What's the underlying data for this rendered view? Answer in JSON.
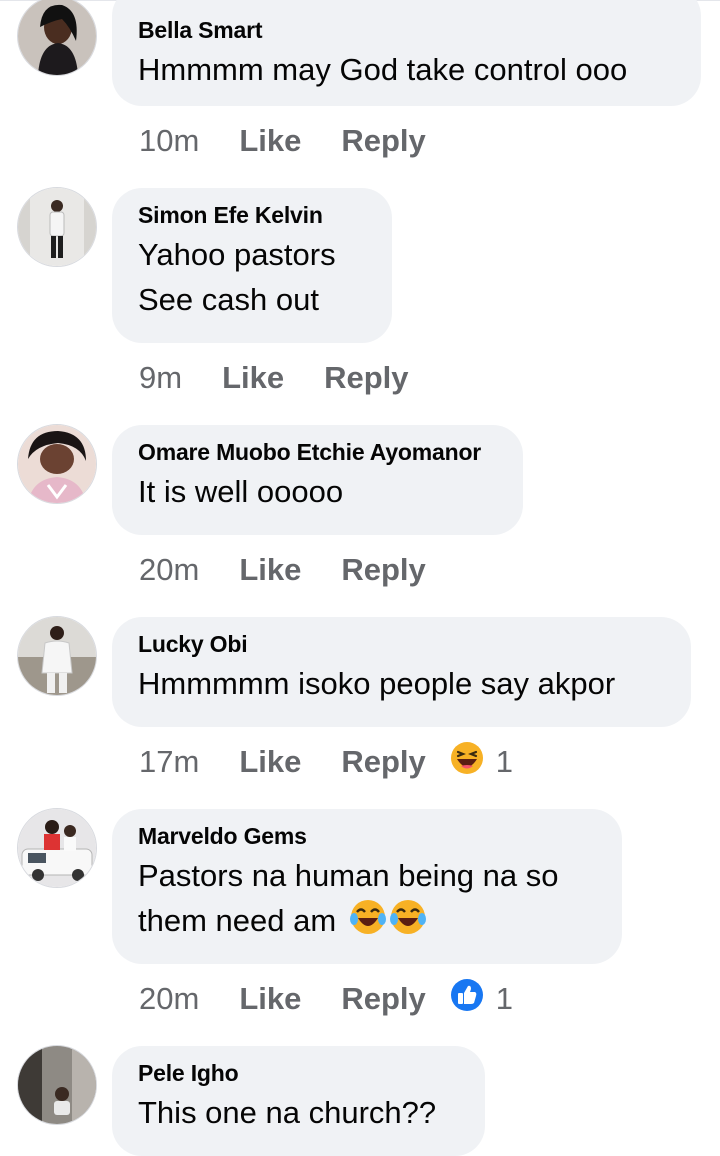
{
  "comments": [
    {
      "author": "Bella Smart",
      "lines": [
        "Hmmmm may God take control ooo"
      ],
      "time": "10m",
      "like": "Like",
      "reply": "Reply",
      "reaction": null
    },
    {
      "author": "Simon Efe Kelvin",
      "lines": [
        "Yahoo pastors",
        "See cash out"
      ],
      "time": "9m",
      "like": "Like",
      "reply": "Reply",
      "reaction": null
    },
    {
      "author": "Omare Muobo Etchie Ayomanor",
      "lines": [
        "It is well ooooo"
      ],
      "time": "20m",
      "like": "Like",
      "reply": "Reply",
      "reaction": null
    },
    {
      "author": "Lucky Obi",
      "lines": [
        "Hmmmmm isoko people say akpor"
      ],
      "time": "17m",
      "like": "Like",
      "reply": "Reply",
      "reaction": {
        "type": "haha-emoji-icon",
        "count": "1"
      }
    },
    {
      "author": "Marveldo Gems",
      "lines": [
        "Pastors na human being na so",
        "them need am"
      ],
      "time": "20m",
      "like": "Like",
      "reply": "Reply",
      "reaction": {
        "type": "like-thumb-icon",
        "count": "1"
      }
    },
    {
      "author": "Pele Igho",
      "lines": [
        "This one na church??"
      ],
      "time": "",
      "like": "",
      "reply": "",
      "reaction": null
    }
  ],
  "colors": {
    "bubble": "#f0f2f5",
    "meta_text": "#65676b",
    "like_blue": "#1877f2",
    "emoji_yellow": "#f7b125"
  }
}
